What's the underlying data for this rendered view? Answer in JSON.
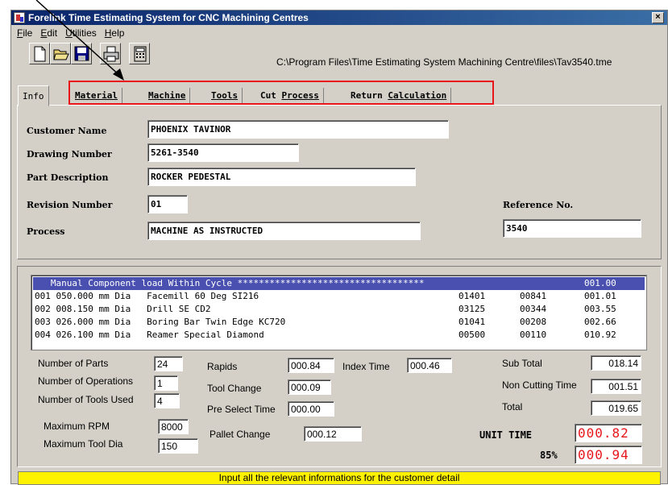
{
  "window": {
    "title": "Forelink Time Estimating System for CNC Machining Centres",
    "close_label": "×"
  },
  "menu": [
    {
      "u": "F",
      "rest": "ile"
    },
    {
      "u": "E",
      "rest": "dit"
    },
    {
      "u": "U",
      "rest": "tilities"
    },
    {
      "u": "H",
      "rest": "elp"
    }
  ],
  "toolbar": {
    "buttons": [
      "new-icon",
      "open-icon",
      "save-icon",
      "print-icon",
      "calculator-icon"
    ],
    "file_path": "C:\\Program Files\\Time Estimating System Machining Centre\\files\\Tav3540.tme"
  },
  "tabs": [
    {
      "u": "",
      "rest": "Info"
    },
    {
      "u": "M",
      "rest": "aterial"
    },
    {
      "u": "M",
      "rest": "achine"
    },
    {
      "u": "T",
      "rest": "ools"
    },
    {
      "u": "",
      "pre": "Cut ",
      "u2": "P",
      "rest": "rocess"
    },
    {
      "u": "",
      "pre": "Return ",
      "u2": "C",
      "rest": "alculation"
    }
  ],
  "info": {
    "customer_name_label": "Customer Name",
    "customer_name": "PHOENIX TAVINOR",
    "drawing_number_label": "Drawing Number",
    "drawing_number": "5261-3540",
    "part_description_label": "Part Description",
    "part_description": "ROCKER PEDESTAL",
    "revision_number_label": "Revision Number",
    "revision_number": "01",
    "reference_label": "Reference No.",
    "reference": "3540",
    "process_label": "Process",
    "process": "MACHINE AS INSTRUCTED"
  },
  "operations": [
    {
      "desc": "   Manual Component load Within Cycle ***********************************",
      "c1": "",
      "c2": "",
      "c3": "001.00"
    },
    {
      "desc": "001 050.000 mm Dia   Facemill 60 Deg SI216",
      "c1": "01401",
      "c2": "00841",
      "c3": "001.01"
    },
    {
      "desc": "002 008.150 mm Dia   Drill SE CD2",
      "c1": "03125",
      "c2": "00344",
      "c3": "003.55"
    },
    {
      "desc": "003 026.000 mm Dia   Boring Bar Twin Edge KC720",
      "c1": "01041",
      "c2": "00208",
      "c3": "002.66"
    },
    {
      "desc": "004 026.100 mm Dia   Reamer Special Diamond",
      "c1": "00500",
      "c2": "00110",
      "c3": "010.92"
    }
  ],
  "summary": {
    "num_parts_label": "Number of Parts",
    "num_parts": "24",
    "num_ops_label": "Number of Operations",
    "num_ops": "1",
    "num_tools_label": "Number of Tools Used",
    "num_tools": "4",
    "max_rpm_label": "Maximum RPM",
    "max_rpm": "8000",
    "max_tool_dia_label": "Maximum Tool Dia",
    "max_tool_dia": "150",
    "rapids_label": "Rapids",
    "rapids": "000.84",
    "tool_change_label": "Tool Change",
    "tool_change": "000.09",
    "pre_select_label": "Pre Select Time",
    "pre_select": "000.00",
    "pallet_change_label": "Pallet Change",
    "pallet_change": "000.12",
    "index_time_label": "Index Time",
    "index_time": "000.46",
    "sub_total_label": "Sub Total",
    "sub_total": "018.14",
    "non_cutting_label": "Non Cutting Time",
    "non_cutting": "001.51",
    "total_label": "Total",
    "total": "019.65",
    "unit_time_label": "UNIT TIME",
    "unit_time": "000.82",
    "pct_label": "85%",
    "pct_value": "000.94"
  },
  "status": "Input all the relevant informations for the customer detail",
  "colors": {
    "highlight": "#e8161b",
    "status_bg": "#fff200",
    "title_bar": "#0a246a"
  }
}
